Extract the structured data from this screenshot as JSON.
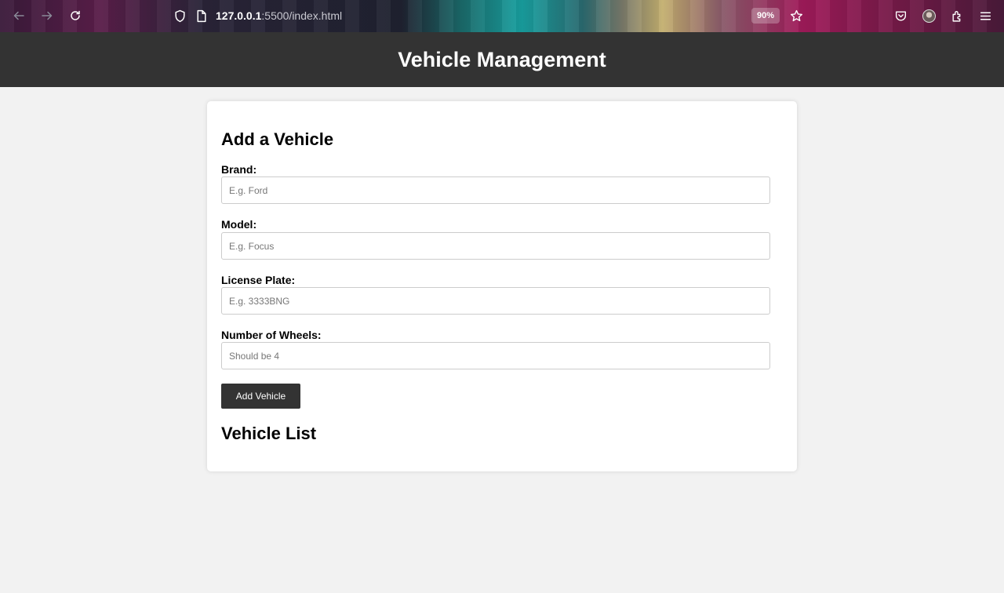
{
  "browser": {
    "url_host": "127.0.0.1",
    "url_rest": ":5500/index.html",
    "zoom": "90%",
    "icons": [
      "back-arrow-icon",
      "forward-arrow-icon",
      "reload-icon",
      "shield-icon",
      "page-icon",
      "star-icon",
      "pocket-icon",
      "avatar",
      "extensions-icon",
      "menu-icon"
    ]
  },
  "header": {
    "title": "Vehicle Management"
  },
  "form": {
    "title": "Add a Vehicle",
    "fields": [
      {
        "label": "Brand:",
        "placeholder": "E.g. Ford",
        "value": ""
      },
      {
        "label": "Model:",
        "placeholder": "E.g. Focus",
        "value": ""
      },
      {
        "label": "License Plate:",
        "placeholder": "E.g. 3333BNG",
        "value": ""
      },
      {
        "label": "Number of Wheels:",
        "placeholder": "Should be 4",
        "value": ""
      }
    ],
    "submit_label": "Add Vehicle"
  },
  "list": {
    "title": "Vehicle List",
    "items": []
  }
}
